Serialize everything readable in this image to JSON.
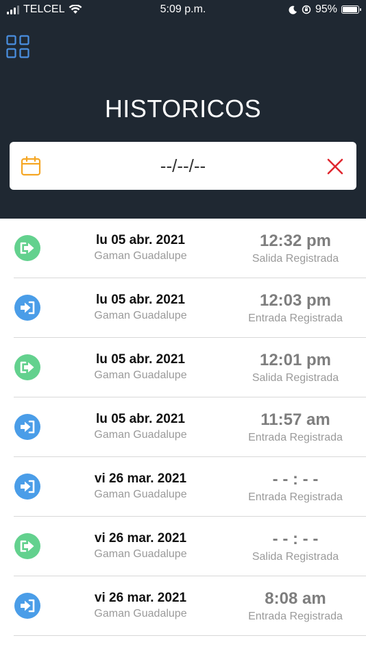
{
  "status_bar": {
    "carrier": "TELCEL",
    "time": "5:09 p.m.",
    "battery": "95%",
    "battery_level": 0.95
  },
  "header": {
    "title": "HISTORICOS"
  },
  "date_filter": {
    "value": "--/--/--"
  },
  "colors": {
    "header_bg": "#1f2832",
    "accent_blue": "#4a90e2",
    "salida_green": "#63d18e",
    "entrada_blue": "#4a9de8",
    "calendar_orange": "#f5a623",
    "clear_red": "#e0262e"
  },
  "records": [
    {
      "type": "salida",
      "icon": "exit-icon",
      "date": "lu 05 abr. 2021",
      "place": "Gaman Guadalupe",
      "time": "12:32 pm",
      "status": "Salida Registrada"
    },
    {
      "type": "entrada",
      "icon": "enter-icon",
      "date": "lu 05 abr. 2021",
      "place": "Gaman Guadalupe",
      "time": "12:03 pm",
      "status": "Entrada Registrada"
    },
    {
      "type": "salida",
      "icon": "exit-icon",
      "date": "lu 05 abr. 2021",
      "place": "Gaman Guadalupe",
      "time": "12:01 pm",
      "status": "Salida Registrada"
    },
    {
      "type": "entrada",
      "icon": "enter-icon",
      "date": "lu 05 abr. 2021",
      "place": "Gaman Guadalupe",
      "time": "11:57 am",
      "status": "Entrada Registrada"
    },
    {
      "type": "entrada",
      "icon": "enter-icon",
      "date": "vi 26 mar. 2021",
      "place": "Gaman Guadalupe",
      "time": "- - : - -",
      "status": "Entrada Registrada"
    },
    {
      "type": "salida",
      "icon": "exit-icon",
      "date": "vi 26 mar. 2021",
      "place": "Gaman Guadalupe",
      "time": "- - : - -",
      "status": "Salida Registrada"
    },
    {
      "type": "entrada",
      "icon": "enter-icon",
      "date": "vi 26 mar. 2021",
      "place": "Gaman Guadalupe",
      "time": "8:08 am",
      "status": "Entrada Registrada"
    }
  ]
}
